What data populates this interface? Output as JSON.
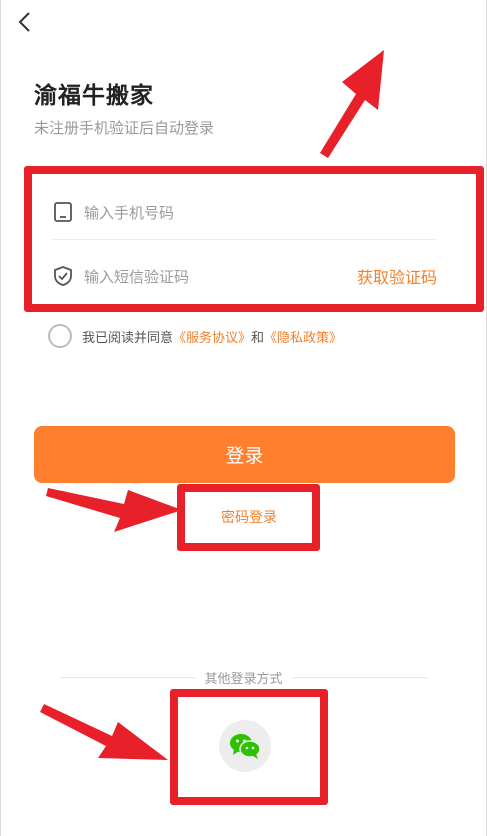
{
  "header": {
    "title": "渝福牛搬家",
    "subtitle": "未注册手机验证后自动登录"
  },
  "form": {
    "phone_placeholder": "输入手机号码",
    "code_placeholder": "输入短信验证码",
    "get_code_label": "获取验证码"
  },
  "agreement": {
    "prefix": "我已阅读并同意",
    "service_link": "《服务协议》",
    "and": "和",
    "privacy_link": "《隐私政策》"
  },
  "actions": {
    "login_label": "登录",
    "password_login_label": "密码登录"
  },
  "other_login": {
    "label": "其他登录方式",
    "methods": [
      "wechat-icon"
    ]
  },
  "colors": {
    "accent": "#ff7f2f",
    "link": "#f57f2a",
    "annotation": "#e8202a",
    "wechat": "#2dc100"
  }
}
